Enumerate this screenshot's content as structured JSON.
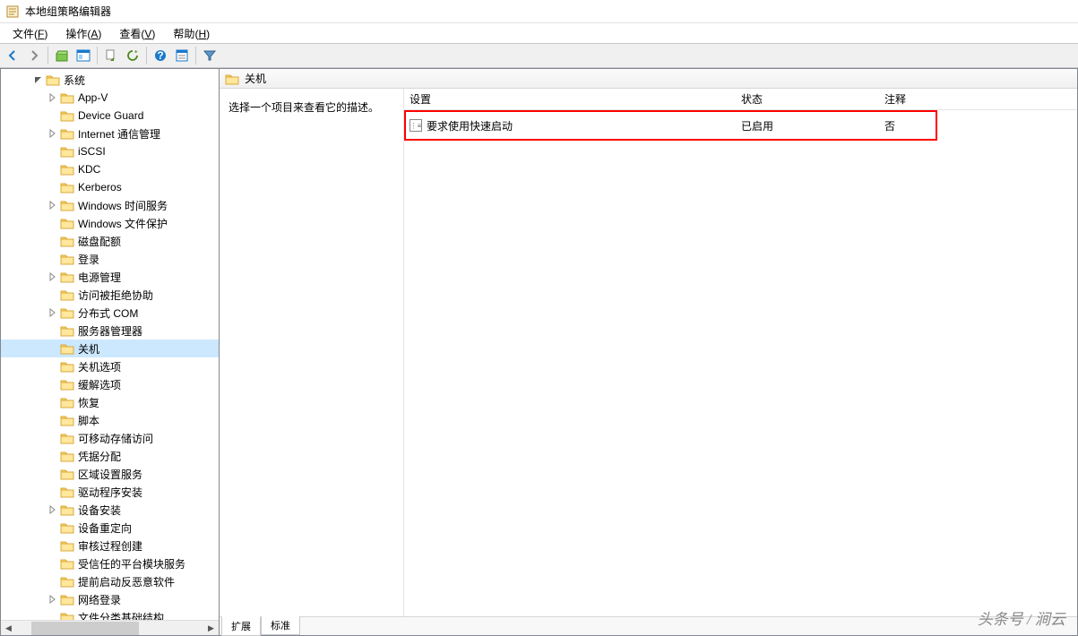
{
  "window": {
    "title": "本地组策略编辑器"
  },
  "menu": {
    "file": "文件",
    "file_key": "F",
    "action": "操作",
    "action_key": "A",
    "view": "查看",
    "view_key": "V",
    "help": "帮助",
    "help_key": "H"
  },
  "tree": {
    "root": {
      "label": "系统",
      "expanded": true
    },
    "items": [
      {
        "label": "App-V",
        "expandable": true,
        "depth": 1
      },
      {
        "label": "Device Guard",
        "expandable": false,
        "depth": 1
      },
      {
        "label": "Internet 通信管理",
        "expandable": true,
        "depth": 1
      },
      {
        "label": "iSCSI",
        "expandable": false,
        "depth": 1
      },
      {
        "label": "KDC",
        "expandable": false,
        "depth": 1
      },
      {
        "label": "Kerberos",
        "expandable": false,
        "depth": 1
      },
      {
        "label": "Windows 时间服务",
        "expandable": true,
        "depth": 1
      },
      {
        "label": "Windows 文件保护",
        "expandable": false,
        "depth": 1
      },
      {
        "label": "磁盘配额",
        "expandable": false,
        "depth": 1
      },
      {
        "label": "登录",
        "expandable": false,
        "depth": 1
      },
      {
        "label": "电源管理",
        "expandable": true,
        "depth": 1
      },
      {
        "label": "访问被拒绝协助",
        "expandable": false,
        "depth": 1
      },
      {
        "label": "分布式 COM",
        "expandable": true,
        "depth": 1
      },
      {
        "label": "服务器管理器",
        "expandable": false,
        "depth": 1
      },
      {
        "label": "关机",
        "expandable": false,
        "depth": 1,
        "selected": true
      },
      {
        "label": "关机选项",
        "expandable": false,
        "depth": 1
      },
      {
        "label": "缓解选项",
        "expandable": false,
        "depth": 1
      },
      {
        "label": "恢复",
        "expandable": false,
        "depth": 1
      },
      {
        "label": "脚本",
        "expandable": false,
        "depth": 1
      },
      {
        "label": "可移动存储访问",
        "expandable": false,
        "depth": 1
      },
      {
        "label": "凭据分配",
        "expandable": false,
        "depth": 1
      },
      {
        "label": "区域设置服务",
        "expandable": false,
        "depth": 1
      },
      {
        "label": "驱动程序安装",
        "expandable": false,
        "depth": 1
      },
      {
        "label": "设备安装",
        "expandable": true,
        "depth": 1
      },
      {
        "label": "设备重定向",
        "expandable": false,
        "depth": 1
      },
      {
        "label": "审核过程创建",
        "expandable": false,
        "depth": 1
      },
      {
        "label": "受信任的平台模块服务",
        "expandable": false,
        "depth": 1
      },
      {
        "label": "提前启动反恶意软件",
        "expandable": false,
        "depth": 1
      },
      {
        "label": "网络登录",
        "expandable": true,
        "depth": 1
      },
      {
        "label": "文件分类基础结构",
        "expandable": false,
        "depth": 1
      }
    ]
  },
  "details": {
    "path": "关机",
    "description": "选择一个项目来查看它的描述。",
    "columns": {
      "setting": "设置",
      "state": "状态",
      "comment": "注释"
    },
    "rows": [
      {
        "setting": "要求使用快速启动",
        "state": "已启用",
        "comment": "否"
      }
    ]
  },
  "tabs": {
    "extended": "扩展",
    "standard": "标准"
  },
  "watermark": "头条号 / 涧云"
}
